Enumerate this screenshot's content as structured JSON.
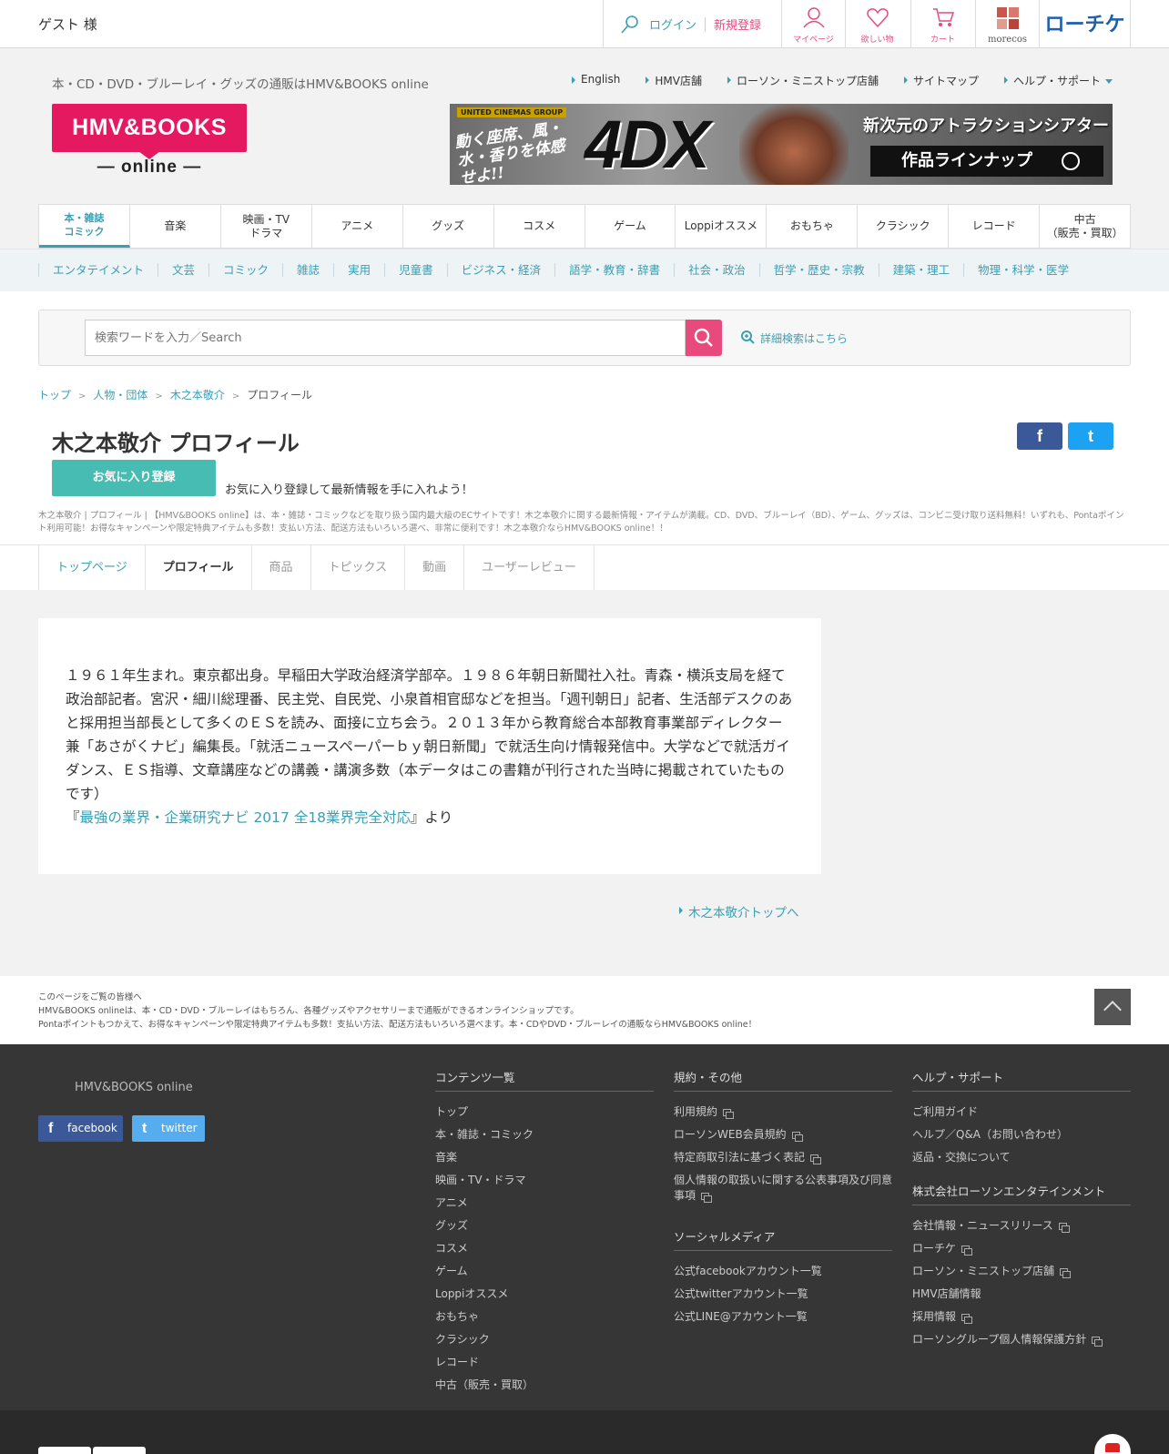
{
  "topbar": {
    "guest": "ゲスト 様",
    "login": "ログイン",
    "signup": "新規登録",
    "icons": [
      {
        "name": "mypage",
        "label": "マイページ"
      },
      {
        "name": "wishlist",
        "label": "欲しい物"
      },
      {
        "name": "cart",
        "label": "カート"
      }
    ],
    "morecos": "morecos",
    "lchike": "ローチケ",
    "accent": "#e94a7d"
  },
  "header": {
    "tagline": "本・CD・DVD・ブルーレイ・グッズの通販はHMV&BOOKS online",
    "links": [
      "English",
      "HMV店舗",
      "ローソン・ミニストップ店舗",
      "サイトマップ",
      "ヘルプ・サポート"
    ],
    "logo_main": "HMV&BOOKS",
    "logo_sub": "— online —",
    "banner": {
      "group": "UNITED CINEMAS GROUP",
      "left_text": "動く座席、風・水・香りを体感せよ!!",
      "brand": "4DX",
      "headline": "新次元のアトラクションシアター",
      "button": "作品ラインナップ"
    }
  },
  "main_nav": [
    {
      "label": "本・雑誌\nコミック",
      "active": true
    },
    {
      "label": "音楽"
    },
    {
      "label": "映画・TV\nドラマ"
    },
    {
      "label": "アニメ"
    },
    {
      "label": "グッズ"
    },
    {
      "label": "コスメ"
    },
    {
      "label": "ゲーム"
    },
    {
      "label": "Loppiオススメ"
    },
    {
      "label": "おもちゃ"
    },
    {
      "label": "クラシック"
    },
    {
      "label": "レコード"
    },
    {
      "label": "中古\n（販売・買取）"
    }
  ],
  "sub_nav": [
    "エンタテイメント",
    "文芸",
    "コミック",
    "雑誌",
    "実用",
    "児童書",
    "ビジネス・経済",
    "語学・教育・辞書",
    "社会・政治",
    "哲学・歴史・宗教",
    "建築・理工",
    "物理・科学・医学"
  ],
  "search": {
    "placeholder": "検索ワードを入力／Search",
    "advanced": "詳細検索はこちら"
  },
  "breadcrumb": [
    "トップ",
    "人物・団体",
    "木之本敬介",
    "プロフィール"
  ],
  "page": {
    "title": "木之本敬介 プロフィール",
    "fav_button": "お気に入り登録",
    "fav_text": "お気に入り登録して最新情報を手に入れよう！",
    "meta": "木之本敬介 | プロフィール | 【HMV&BOOKS online】は、本・雑誌・コミックなどを取り扱う国内最大級のECサイトです！木之本敬介に関する最新情報・アイテムが満載。CD、DVD、ブルーレイ（BD）、ゲーム、グッズは、コンビニ受け取り送料無料！いずれも、Pontaポイント利用可能！お得なキャンペーンや限定特典アイテムも多数！支払い方法、配送方法もいろいろ選べ、非常に便利です！木之本敬介ならHMV&BOOKS online！！",
    "social": [
      "f",
      "t"
    ]
  },
  "tabs": [
    {
      "label": "トップページ",
      "state": "link"
    },
    {
      "label": "プロフィール",
      "state": "on"
    },
    {
      "label": "商品",
      "state": "off"
    },
    {
      "label": "トピックス",
      "state": "off"
    },
    {
      "label": "動画",
      "state": "off"
    },
    {
      "label": "ユーザーレビュー",
      "state": "off"
    }
  ],
  "profile": {
    "body": "１９６１年生まれ。東京都出身。早稲田大学政治経済学部卒。１９８６年朝日新聞社入社。青森・横浜支局を経て政治部記者。宮沢・細川総理番、民主党、自民党、小泉首相官邸などを担当。「週刊朝日」記者、生活部デスクのあと採用担当部長として多くのＥＳを読み、面接に立ち会う。２０１３年から教育総合本部教育事業部ディレクター兼「あさがくナビ」編集長。「就活ニュースペーパーｂｙ朝日新聞」で就活生向け情報発信中。大学などで就活ガイダンス、ＥＳ指導、文章講座などの講義・講演多数（本データはこの書籍が刊行された当時に掲載されていたものです）",
    "src_open": "『",
    "src_title": "最強の業界・企業研究ナビ 2017 全18業界完全対応",
    "src_close": "』より",
    "back_link": "木之本敬介トップへ"
  },
  "footnote": [
    "このページをご覧の皆様へ",
    "HMV&BOOKS onlineは、本・CD・DVD・ブルーレイはもちろん、各種グッズやアクセサリーまで通販ができるオンラインショップです。",
    "Pontaポイントもつかえて、お得なキャンペーンや限定特典アイテムも多数！支払い方法、配送方法もいろいろ選べます。本・CDやDVD・ブルーレイの通販ならHMV&BOOKS online！"
  ],
  "footer": {
    "brand": "HMV&BOOKS online",
    "facebook": "facebook",
    "twitter": "twitter",
    "col1": {
      "title": "コンテンツ一覧",
      "items": [
        "トップ",
        "本・雑誌・コミック",
        "音楽",
        "映画・TV・ドラマ",
        "アニメ",
        "グッズ",
        "コスメ",
        "ゲーム",
        "Loppiオススメ",
        "おもちゃ",
        "クラシック",
        "レコード",
        "中古（販売・買取）"
      ]
    },
    "col2": {
      "title": "規約・その他",
      "items": [
        "利用規約",
        "ローソンWEB会員規約",
        "特定商取引法に基づく表記",
        "個人情報の取扱いに関する公表事項及び同意事項"
      ],
      "title2": "ソーシャルメディア",
      "items2": [
        "公式facebookアカウント一覧",
        "公式twitterアカウント一覧",
        "公式LINE@アカウント一覧"
      ]
    },
    "col3": {
      "title": "ヘルプ・サポート",
      "items": [
        "ご利用ガイド",
        "ヘルプ／Q&A（お問い合わせ）",
        "返品・交換について"
      ],
      "title2": "株式会社ローソンエンタテインメント",
      "items2": [
        "会社情報・ニュースリリース",
        "ローチケ",
        "ローソン・ミニストップ店舗",
        "HMV店舗情報",
        "採用情報",
        "ローソングループ個人情報保護方針"
      ]
    }
  }
}
